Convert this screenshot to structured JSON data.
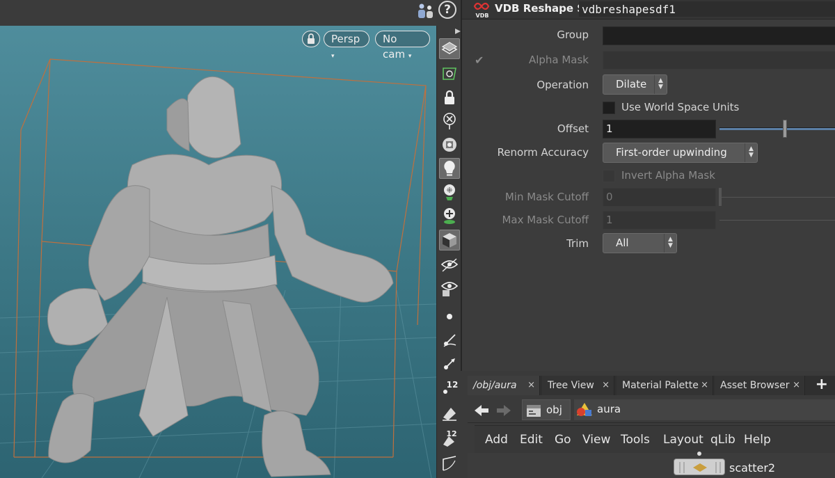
{
  "viewport": {
    "camera_mode": "Persp",
    "camera_name": "No cam",
    "colors": {
      "background_top": "#4f8d9c",
      "background_bottom": "#2d6472",
      "bbox": "#c0703e",
      "model": "#a9a9a9"
    }
  },
  "shelf": {
    "items": [
      {
        "name": "display-options-icon",
        "active": true
      },
      {
        "name": "select-mode-icon",
        "active": false
      },
      {
        "name": "lock-icon",
        "active": false
      },
      {
        "name": "hide-selected-icon",
        "active": false
      },
      {
        "name": "flipbook-icon",
        "active": false
      },
      {
        "name": "headlight-icon",
        "active": true
      },
      {
        "name": "light-icon",
        "active": false
      },
      {
        "name": "light-plus-icon",
        "active": false
      },
      {
        "name": "shaded-cube-icon",
        "active": true
      },
      {
        "name": "visibility-eye-icon",
        "active": false
      },
      {
        "name": "visibility-eye-2-icon",
        "active": false
      },
      {
        "name": "point-icon",
        "active": false
      },
      {
        "name": "normal-icon",
        "active": false
      },
      {
        "name": "vector-icon",
        "active": false
      },
      {
        "name": "point-numbers-icon",
        "active": false,
        "badge": "12"
      },
      {
        "name": "primitive-icon",
        "active": false
      },
      {
        "name": "primitive-numbers-icon",
        "active": false,
        "badge": "12"
      },
      {
        "name": "uv-icon",
        "active": false
      }
    ]
  },
  "params": {
    "node_type_badge": "VDB",
    "node_type": "VDB Reshape SDF",
    "node_name": "vdbreshapesdf1",
    "group_label": "Group",
    "group_value": "",
    "alpha_mask_label": "Alpha Mask",
    "alpha_mask_value": "",
    "operation_label": "Operation",
    "operation_value": "Dilate",
    "world_space_label": "Use World Space Units",
    "offset_label": "Offset",
    "offset_value": "1",
    "renorm_label": "Renorm Accuracy",
    "renorm_value": "First-order upwinding",
    "invert_alpha_label": "Invert Alpha Mask",
    "min_mask_label": "Min Mask Cutoff",
    "min_mask_value": "0",
    "max_mask_label": "Max Mask Cutoff",
    "max_mask_value": "1",
    "trim_label": "Trim",
    "trim_value": "All"
  },
  "network": {
    "tabs": [
      {
        "label": "/obj/aura",
        "close": "×"
      },
      {
        "label": "Tree View",
        "close": "×"
      },
      {
        "label": "Material Palette",
        "close": "×"
      },
      {
        "label": "Asset Browser",
        "close": "×"
      }
    ],
    "add_tab": "+",
    "path": {
      "obj": "obj",
      "aura": "aura"
    },
    "menu": [
      "Add",
      "Edit",
      "Go",
      "View",
      "Tools",
      "Layout",
      "qLib",
      "Help"
    ],
    "node_label": "scatter2"
  }
}
